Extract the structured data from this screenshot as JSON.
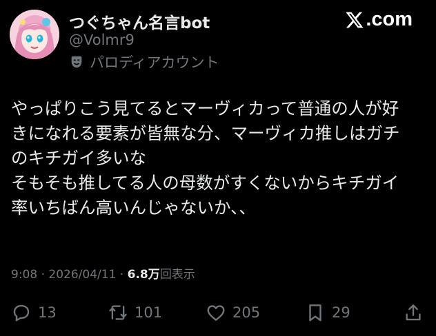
{
  "account": {
    "display_name": "つぐちゃん名言bot",
    "handle": "@Volmr9",
    "parody_label": "パロディアカウント",
    "avatar_icon": "anime-girl-avatar",
    "parody_icon": "theater-mask-icon"
  },
  "brand": {
    "text": ".com",
    "icon": "x-logo-icon"
  },
  "tweet": {
    "lines": [
      "やっぱりこう見てるとマーヴィカって普通の人が好",
      "きになれる要素が皆無な分、マーヴィカ推しはガチ",
      "のキチガイ多いな",
      "そもそも推してる人の母数がすくないからキチガイ",
      "率いちばん高いんじゃないか、、"
    ]
  },
  "meta": {
    "time": "9:08",
    "separator": " · ",
    "date": "2026/04/11",
    "separator2": " · ",
    "views_count": "6.8万",
    "views_label": "回表示"
  },
  "actions": {
    "replies": "13",
    "retweets": "101",
    "likes": "205",
    "bookmarks": "29"
  },
  "colors": {
    "background": "#000000",
    "primary_text": "#e7e9ea",
    "secondary_text": "#71767b"
  }
}
